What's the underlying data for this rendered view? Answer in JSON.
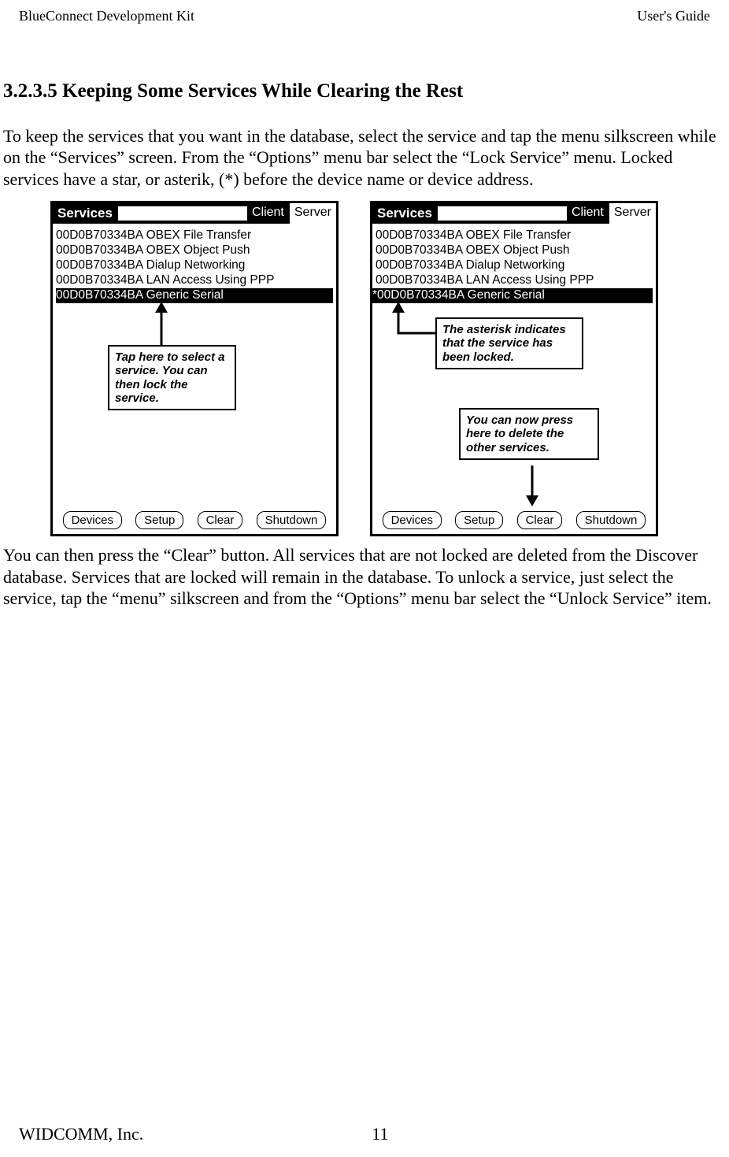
{
  "header": {
    "left": "BlueConnect Development Kit",
    "right": "User's Guide"
  },
  "section": {
    "number": "3.2.3.5",
    "title": "Keeping Some Services While Clearing the Rest"
  },
  "para1": "To keep the services that you want in the database, select the service and tap the menu silkscreen while on the “Services” screen. From the “Options” menu bar select the “Lock Service” menu. Locked services have a star, or asterik, (*) before the device name or device address.",
  "para2": "You can then press the “Clear” button.  All services that are not locked are deleted from the Discover database. Services that are locked will remain in the database. To unlock a service, just select the service, tap the “menu” silkscreen and from the “Options” menu bar select the “Unlock Service” item.",
  "screenLeft": {
    "title": "Services",
    "role": "Client",
    "server": "Server",
    "callout": "Tap here to select a service.  You can then lock the service.",
    "items": [
      {
        "text": "00D0B70334BA OBEX File Transfer",
        "selected": false
      },
      {
        "text": "00D0B70334BA OBEX Object Push",
        "selected": false
      },
      {
        "text": "00D0B70334BA Dialup Networking",
        "selected": false
      },
      {
        "text": "00D0B70334BA LAN Access Using PPP",
        "selected": false
      },
      {
        "text": "00D0B70334BA Generic Serial",
        "selected": true
      }
    ],
    "buttons": {
      "devices": "Devices",
      "setup": "Setup",
      "clear": "Clear",
      "shutdown": "Shutdown"
    }
  },
  "screenRight": {
    "title": "Services",
    "role": "Client",
    "server": "Server",
    "calloutTop": "The asterisk indicates that  the service has been locked.",
    "calloutBottom": "You can now press here to delete the other services.",
    "items": [
      {
        "text": "00D0B70334BA OBEX File Transfer",
        "selected": false
      },
      {
        "text": "00D0B70334BA OBEX Object Push",
        "selected": false
      },
      {
        "text": "00D0B70334BA Dialup Networking",
        "selected": false
      },
      {
        "text": "00D0B70334BA LAN Access Using PPP",
        "selected": false
      },
      {
        "text": "*00D0B70334BA Generic Serial",
        "selected": true
      }
    ],
    "buttons": {
      "devices": "Devices",
      "setup": "Setup",
      "clear": "Clear",
      "shutdown": "Shutdown"
    }
  },
  "footer": {
    "company": "WIDCOMM, Inc.",
    "page": "11"
  }
}
